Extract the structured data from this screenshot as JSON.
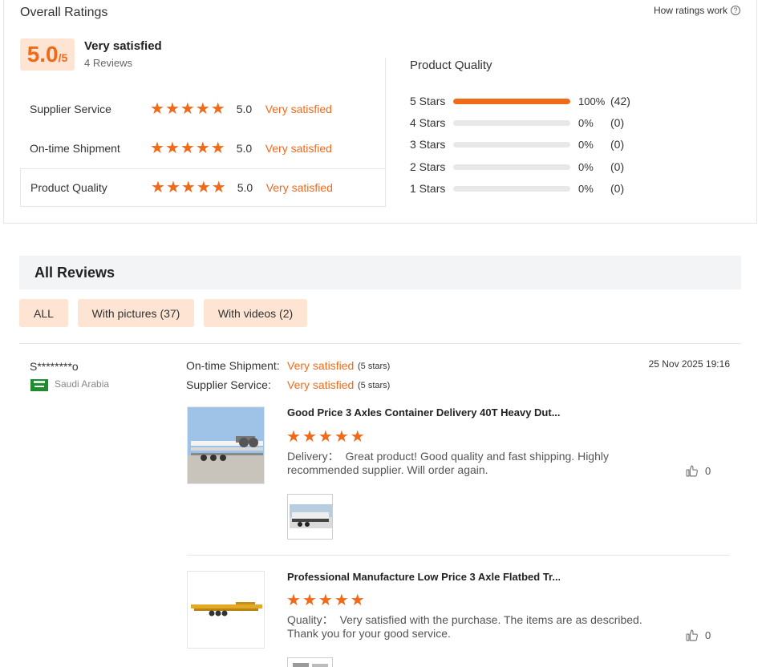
{
  "overall": {
    "title": "Overall Ratings",
    "how_ratings_work": "How ratings work",
    "help_glyph": "?",
    "score": "5.0",
    "score_denominator": "/5",
    "summary_label": "Very satisfied",
    "review_count": "4 Reviews"
  },
  "sub_ratings": [
    {
      "label": "Supplier Service",
      "stars": 5,
      "score": "5.0",
      "text": "Very satisfied"
    },
    {
      "label": "On-time Shipment",
      "stars": 5,
      "score": "5.0",
      "text": "Very satisfied"
    },
    {
      "label": "Product Quality",
      "stars": 5,
      "score": "5.0",
      "text": "Very satisfied"
    }
  ],
  "distribution": {
    "title": "Product Quality",
    "rows": [
      {
        "label": "5  Stars",
        "fraction": 1.0,
        "pct": "100%",
        "count": "(42)"
      },
      {
        "label": "4  Stars",
        "fraction": 0.0,
        "pct": "0%",
        "count": "(0)"
      },
      {
        "label": "3  Stars",
        "fraction": 0.0,
        "pct": "0%",
        "count": "(0)"
      },
      {
        "label": "2  Stars",
        "fraction": 0.0,
        "pct": "0%",
        "count": "(0)"
      },
      {
        "label": "1  Stars",
        "fraction": 0.0,
        "pct": "0%",
        "count": "(0)"
      }
    ]
  },
  "all_reviews": {
    "title": "All Reviews",
    "filters": [
      "ALL",
      "With pictures (37)",
      "With videos (2)"
    ]
  },
  "review": {
    "reviewer": "S********o",
    "country": "Saudi Arabia",
    "date": "25 Nov 2025 19:16",
    "meta": [
      {
        "label": "On-time Shipment:",
        "value": "Very satisfied",
        "stars": "(5 stars)"
      },
      {
        "label": "Supplier Service:",
        "value": "Very satisfied",
        "stars": "(5 stars)"
      }
    ],
    "items": [
      {
        "title": "Good Price 3 Axles Container Delivery 40T Heavy Dut...",
        "stars": 5,
        "tag": "Delivery：",
        "text": "Great product! Good quality and fast shipping. Highly recommended supplier. Will order again.",
        "likes": "0"
      },
      {
        "title": "Professional Manufacture Low Price 3 Axle Flatbed Tr...",
        "stars": 5,
        "tag": "Quality：",
        "text": "Very satisfied with the purchase. The items are as described. Thank you for your good service.",
        "likes": "0"
      }
    ]
  },
  "colors": {
    "accent": "#f06a1a",
    "badge_bg": "#fde4d3",
    "section_bg": "#f3f4f6"
  },
  "icons": {
    "star": "star-icon",
    "like": "thumbs-up-icon",
    "help": "help-circle-icon",
    "flag": "saudi-flag-icon"
  }
}
